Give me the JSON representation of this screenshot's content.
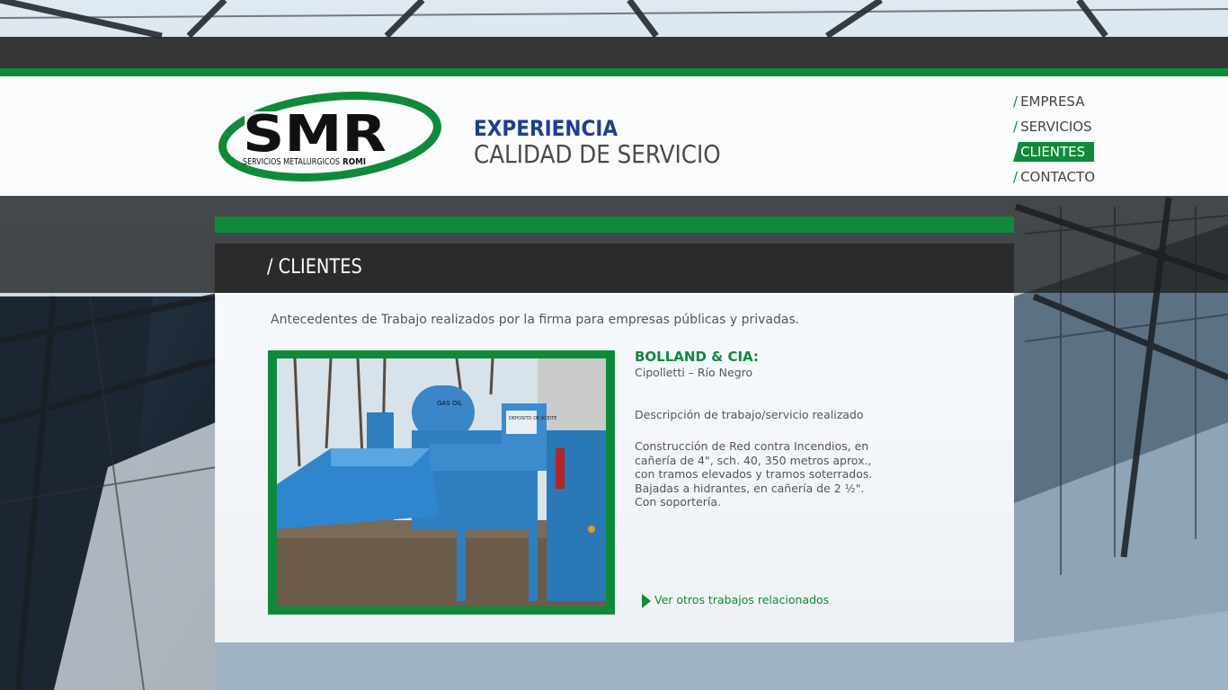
{
  "brand": {
    "logo_letters": "SMR",
    "logo_subtitle_a": "SERVICIOS METALURGICOS",
    "logo_subtitle_b": "ROMI"
  },
  "tagline": {
    "line1": "EXPERIENCIA",
    "line2": "CALIDAD DE SERVICIO"
  },
  "nav": {
    "slash": "/",
    "items": [
      {
        "label": "EMPRESA",
        "active": false
      },
      {
        "label": "SERVICIOS",
        "active": false
      },
      {
        "label": "CLIENTES",
        "active": true
      },
      {
        "label": "CONTACTO",
        "active": false
      }
    ]
  },
  "page": {
    "title": "/ CLIENTES",
    "intro": "Antecedentes de Trabajo realizados por la firma para empresas públicas y privadas."
  },
  "client": {
    "name": "BOLLAND & CIA:",
    "location": "Cipolletti – Río Negro",
    "description_label": "Descripción de trabajo/servicio realizado",
    "description": "Construcción de Red contra Incendios, en cañería de 4\", sch. 40, 350 metros aprox., con tramos elevados  y tramos soterrados. Bajadas a hidrantes, en cañería de 2 ½\". Con soportería.",
    "photo_labels": {
      "tank": "GAS OIL",
      "sign": "DEPOSITO DE ACEITE"
    }
  },
  "more_link": "Ver otros trabajos relacionados",
  "colors": {
    "green": "#0f8a3a",
    "navy": "#1f3e8e",
    "dark": "#262626",
    "machine_blue": "#2f7fc0"
  },
  "icons": {
    "nav_marker": "slash",
    "more_link": "play-arrow-icon"
  }
}
